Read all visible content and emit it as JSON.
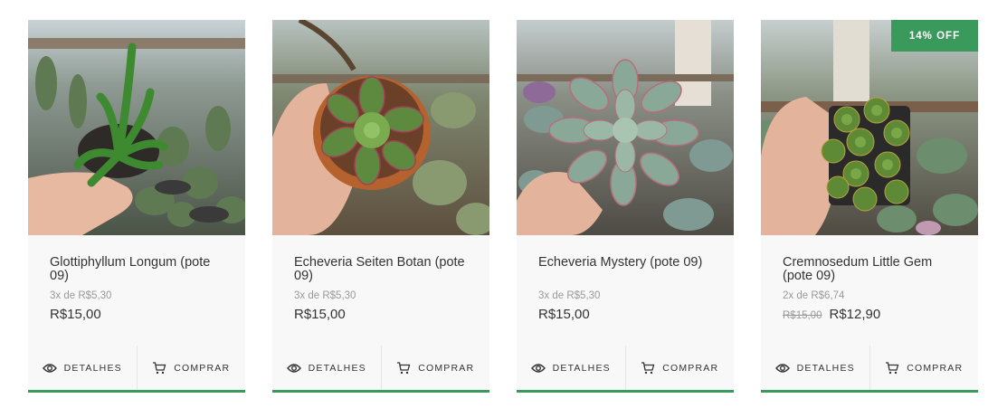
{
  "products": [
    {
      "name": "Glottiphyllum Longum (pote 09)",
      "installments_prefix": "3x de",
      "installment_value": "R$5,30",
      "old_price": "",
      "price": "R$15,00",
      "badge": "",
      "details_label": "DETALHES",
      "buy_label": "COMPRAR"
    },
    {
      "name": "Echeveria Seiten Botan (pote 09)",
      "installments_prefix": "3x de",
      "installment_value": "R$5,30",
      "old_price": "",
      "price": "R$15,00",
      "badge": "",
      "details_label": "DETALHES",
      "buy_label": "COMPRAR"
    },
    {
      "name": "Echeveria Mystery (pote 09)",
      "installments_prefix": "3x de",
      "installment_value": "R$5,30",
      "old_price": "",
      "price": "R$15,00",
      "badge": "",
      "details_label": "DETALHES",
      "buy_label": "COMPRAR"
    },
    {
      "name": "Cremnosedum Little Gem (pote 09)",
      "installments_prefix": "2x de",
      "installment_value": "R$6,74",
      "old_price": "R$15,00",
      "price": "R$12,90",
      "badge": "14% OFF",
      "details_label": "DETALHES",
      "buy_label": "COMPRAR"
    }
  ],
  "colors": {
    "accent": "#3a9a5c",
    "card_bg": "#f8f8f8",
    "text": "#333333",
    "muted": "#999999"
  },
  "icons": {
    "details": "eye-icon",
    "buy": "cart-icon"
  }
}
